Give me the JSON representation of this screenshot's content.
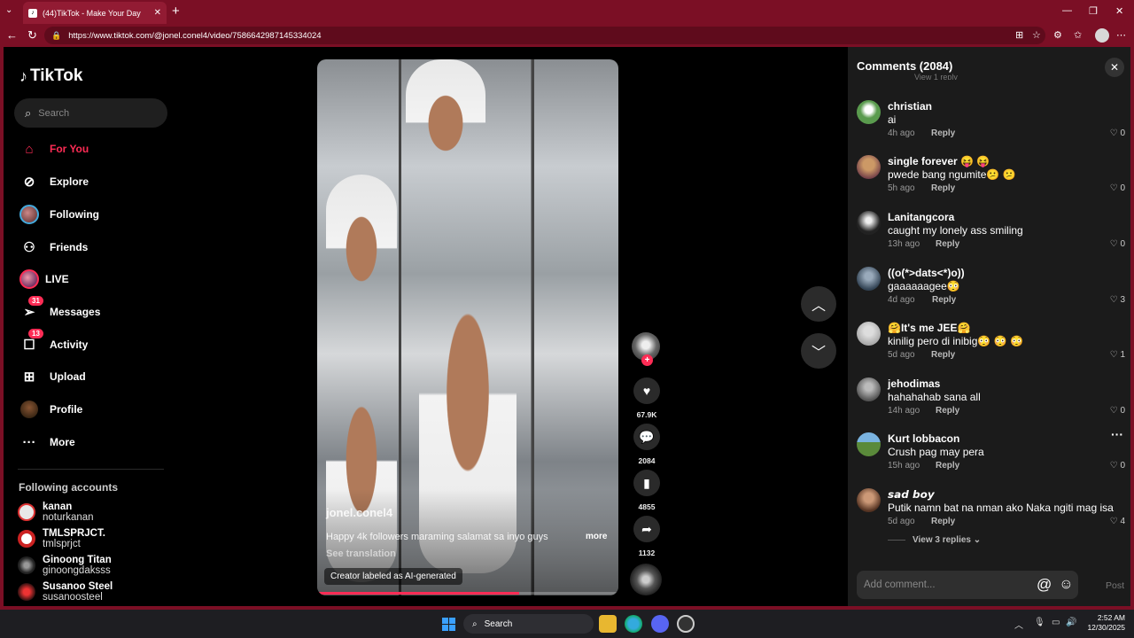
{
  "browser": {
    "tab_title": "(44)TikTok - Make Your Day",
    "url": "https://www.tiktok.com/@jonel.conel4/video/7586642987145334024"
  },
  "sidebar": {
    "logo": "TikTok",
    "search_placeholder": "Search",
    "nav": [
      {
        "label": "For You",
        "icon": "home-icon",
        "active": true
      },
      {
        "label": "Explore",
        "icon": "compass-icon"
      },
      {
        "label": "Following",
        "icon": "avatar"
      },
      {
        "label": "Friends",
        "icon": "friends-icon"
      },
      {
        "label": "LIVE",
        "icon": "avatar"
      },
      {
        "label": "Messages",
        "icon": "messages-icon",
        "badge": "31"
      },
      {
        "label": "Activity",
        "icon": "activity-icon",
        "badge": "13"
      },
      {
        "label": "Upload",
        "icon": "upload-icon"
      },
      {
        "label": "Profile",
        "icon": "avatar"
      },
      {
        "label": "More",
        "icon": "more-icon"
      }
    ],
    "following_title": "Following accounts",
    "following": [
      {
        "name": "kanan",
        "handle": "noturkanan"
      },
      {
        "name": "TMLSPRJCT.",
        "handle": "tmlsprjct"
      },
      {
        "name": "Ginoong Titan",
        "handle": "ginoongdaksss"
      },
      {
        "name": "Susanoo Steel",
        "handle": "susanoosteel"
      }
    ]
  },
  "video": {
    "author": "jonel.conel4",
    "caption": "Happy 4k followers maraming salamat sa inyo guys",
    "more": "more",
    "see_translation": "See translation",
    "ai_label": "Creator labeled as AI-generated",
    "progress": 0.67
  },
  "actions": {
    "likes": "67.9K",
    "comments": "2084",
    "saves": "4855",
    "shares": "1132"
  },
  "comments": {
    "title": "Comments (2084)",
    "cut_text": "View 1 reply",
    "items": [
      {
        "user": "christian",
        "text": "ai",
        "time": "4h ago",
        "reply": "Reply",
        "likes": "0"
      },
      {
        "user": "single forever 😝 😝",
        "text": "pwede bang ngumite😕 😕",
        "time": "5h ago",
        "reply": "Reply",
        "likes": "0"
      },
      {
        "user": "Lanitangcora",
        "text": "caught my lonely ass smiling",
        "time": "13h ago",
        "reply": "Reply",
        "likes": "0"
      },
      {
        "user": "((o(*>dats<*)o))",
        "text": "gaaaaaagee😳",
        "time": "4d ago",
        "reply": "Reply",
        "likes": "3"
      },
      {
        "user": "🤗It's me JEE🤗",
        "text": "kinilig pero di inibig😳 😳 😳",
        "time": "5d ago",
        "reply": "Reply",
        "likes": "1"
      },
      {
        "user": "jehodimas",
        "text": "hahahahab sana all",
        "time": "14h ago",
        "reply": "Reply",
        "likes": "0"
      },
      {
        "user": "Kurt lobbacon",
        "text": "Crush pag may pera",
        "time": "15h ago",
        "reply": "Reply",
        "likes": "0"
      },
      {
        "user": "𝙨𝙖𝙙 𝙗𝙤𝙮",
        "text": "Putik namn bat na nman ako Naka ngiti mag isa",
        "time": "5d ago",
        "reply": "Reply",
        "likes": "4"
      }
    ],
    "view_replies": "View 3 replies",
    "input_placeholder": "Add comment...",
    "post": "Post"
  },
  "taskbar": {
    "search": "Search",
    "time": "2:52 AM",
    "date": "12/30/2025"
  },
  "colors": {
    "accent": "#fe2c55",
    "browser_frame": "#7b0f25"
  }
}
